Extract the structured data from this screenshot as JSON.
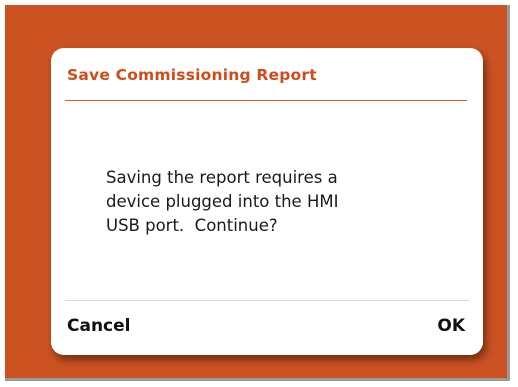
{
  "colors": {
    "backdrop": "#cc5222",
    "title_accent": "#d04c1c",
    "dialog_background": "#ffffff"
  },
  "dialog": {
    "title": "Save Commissioning Report",
    "message_lines": [
      "Saving the report requires a",
      "device plugged into the HMI",
      "USB port.  Continue?"
    ],
    "buttons": {
      "cancel_label": "Cancel",
      "ok_label": "OK"
    }
  }
}
